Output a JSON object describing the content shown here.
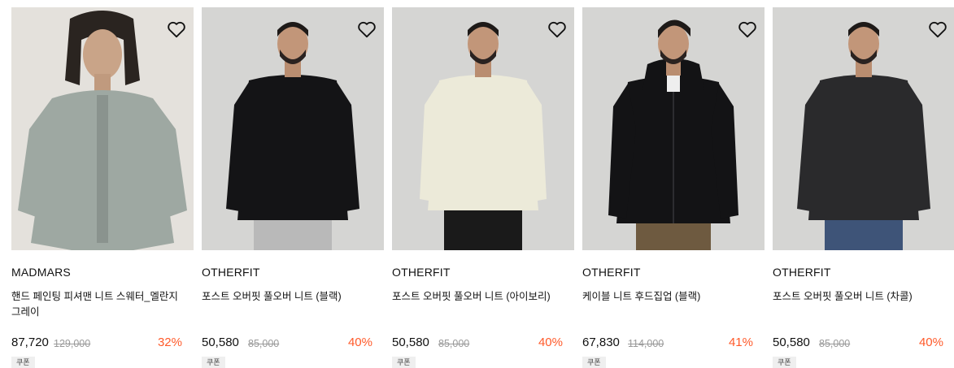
{
  "products": [
    {
      "brand": "MADMARS",
      "name": "핸드 페인팅 피셔맨 니트 스웨터_멜란지 그레이",
      "price": "87,720",
      "original_price": "129,000",
      "discount": "32%",
      "badge": "쿠폰",
      "sweater_color": "#9ea8a2",
      "pants_color": "#9ea8a2",
      "bg_color": "#e4e1dc"
    },
    {
      "brand": "OTHERFIT",
      "name": "포스트 오버핏 풀오버 니트 (블랙)",
      "price": "50,580",
      "original_price": "85,000",
      "discount": "40%",
      "badge": "쿠폰",
      "sweater_color": "#141416",
      "pants_color": "#b9b9b9",
      "bg_color": "#d5d5d3"
    },
    {
      "brand": "OTHERFIT",
      "name": "포스트 오버핏 풀오버 니트 (아이보리)",
      "price": "50,580",
      "original_price": "85,000",
      "discount": "40%",
      "badge": "쿠폰",
      "sweater_color": "#ecead9",
      "pants_color": "#1a1a1a",
      "bg_color": "#d5d5d3"
    },
    {
      "brand": "OTHERFIT",
      "name": "케이블 니트 후드집업 (블랙)",
      "price": "67,830",
      "original_price": "114,000",
      "discount": "41%",
      "badge": "쿠폰",
      "sweater_color": "#131315",
      "pants_color": "#6e5a40",
      "bg_color": "#d5d5d3"
    },
    {
      "brand": "OTHERFIT",
      "name": "포스트 오버핏 풀오버 니트 (차콜)",
      "price": "50,580",
      "original_price": "85,000",
      "discount": "40%",
      "badge": "쿠폰",
      "sweater_color": "#2a2a2c",
      "pants_color": "#3e5478",
      "bg_color": "#d5d5d3"
    }
  ],
  "icons": {
    "wishlist": "heart-outline-icon"
  },
  "colors": {
    "discount": "#ff5a2a",
    "original_price": "#999999"
  }
}
